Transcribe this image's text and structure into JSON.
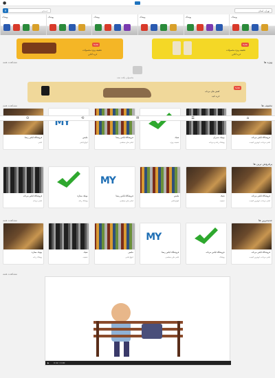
{
  "header": {
    "user_icon": "user-icon",
    "logo": "site-logo"
  },
  "search": {
    "placeholder": "جستجو...",
    "button_icon": "search-icon",
    "location_label": "تهران، استان"
  },
  "categories": [
    {
      "label": "پوشاک"
    },
    {
      "label": "پوشاک"
    },
    {
      "label": "پوشاک"
    },
    {
      "label": "پوشاک"
    },
    {
      "label": "پوشاک"
    },
    {
      "label": "پوشاک"
    }
  ],
  "ads": {
    "left_banner": {
      "tag": "%30",
      "line1": "تخفیف ویژه محصولات",
      "line2": "خرید آنلاین"
    },
    "right_banner": {
      "tag": "%30",
      "line1": "تخفیف ویژه محصولات",
      "line2": "خرید آنلاین"
    },
    "wide_banner": {
      "tag": "%30",
      "line1": "کفش های مردانه",
      "line2": "خرید کنید"
    }
  },
  "sections": {
    "s1": {
      "title": "ویژه ها",
      "link": "مشاهده همه"
    },
    "s2": {
      "title": "تخفیف ها",
      "link": "مشاهده همه"
    },
    "s3": {
      "title": "پرفروش ترین ها",
      "link": ""
    },
    "s4": {
      "title": "جدیدترین ها",
      "link": "مشاهده همه"
    }
  },
  "empty_message": "محصولی یافت نشد",
  "bottom_nav": [
    {
      "label": "⌂",
      "icon": "home-icon"
    },
    {
      "label": "☰",
      "icon": "category-icon"
    },
    {
      "label": "✉",
      "icon": "message-icon"
    },
    {
      "label": "⟲",
      "icon": "refresh-icon"
    },
    {
      "label": "⊙",
      "icon": "profile-icon"
    }
  ],
  "row1": [
    {
      "title": "فروشگاه لباس مردانه",
      "desc": "لباس مردانه با بهترین کیفیت"
    },
    {
      "title": "بوتیک مدیران",
      "desc": "پوشاک زنانه و مردانه"
    },
    {
      "title": "شیک",
      "desc": "تخفیف ویژه"
    },
    {
      "title": "فروشگاه لباس رستا",
      "desc": "لباس های مجلسی"
    },
    {
      "title": "ملبس",
      "desc": "انواع لباس"
    },
    {
      "title": "فروشگاه لباس رستا",
      "desc": "لباس"
    }
  ],
  "row2": [
    {
      "title": "فروشگاه لباس مردانه",
      "desc": "لباس مردانه با بهترین کیفیت"
    },
    {
      "title": "شیک",
      "desc": "تخفیف"
    },
    {
      "title": "ملبس",
      "desc": "انواع لباس"
    },
    {
      "title": "فروشگاه لباس رستا",
      "desc": "لباس های مجلسی"
    },
    {
      "title": "بوتیک ستاره",
      "desc": "پوشاک زنانه"
    },
    {
      "title": "فروشگاه لباس مردانه",
      "desc": "لباس مردانه"
    }
  ],
  "row3": [
    {
      "title": "فروشگاه لباس مردانه",
      "desc": "لباس مردانه با بهترین کیفیت"
    },
    {
      "title": "فروشگاه لباس مردانه",
      "desc": "پوشاک"
    },
    {
      "title": "فروشگاه لباس رستا",
      "desc": "لباس های مجلسی"
    },
    {
      "title": "ملبس",
      "desc": "انواع لباس"
    },
    {
      "title": "شیک",
      "desc": "تخفیف"
    },
    {
      "title": "بوتیک ستاره",
      "desc": "پوشاک زنانه"
    }
  ],
  "video": {
    "time": "0:00 / 0:42",
    "play_icon": "play-icon"
  }
}
